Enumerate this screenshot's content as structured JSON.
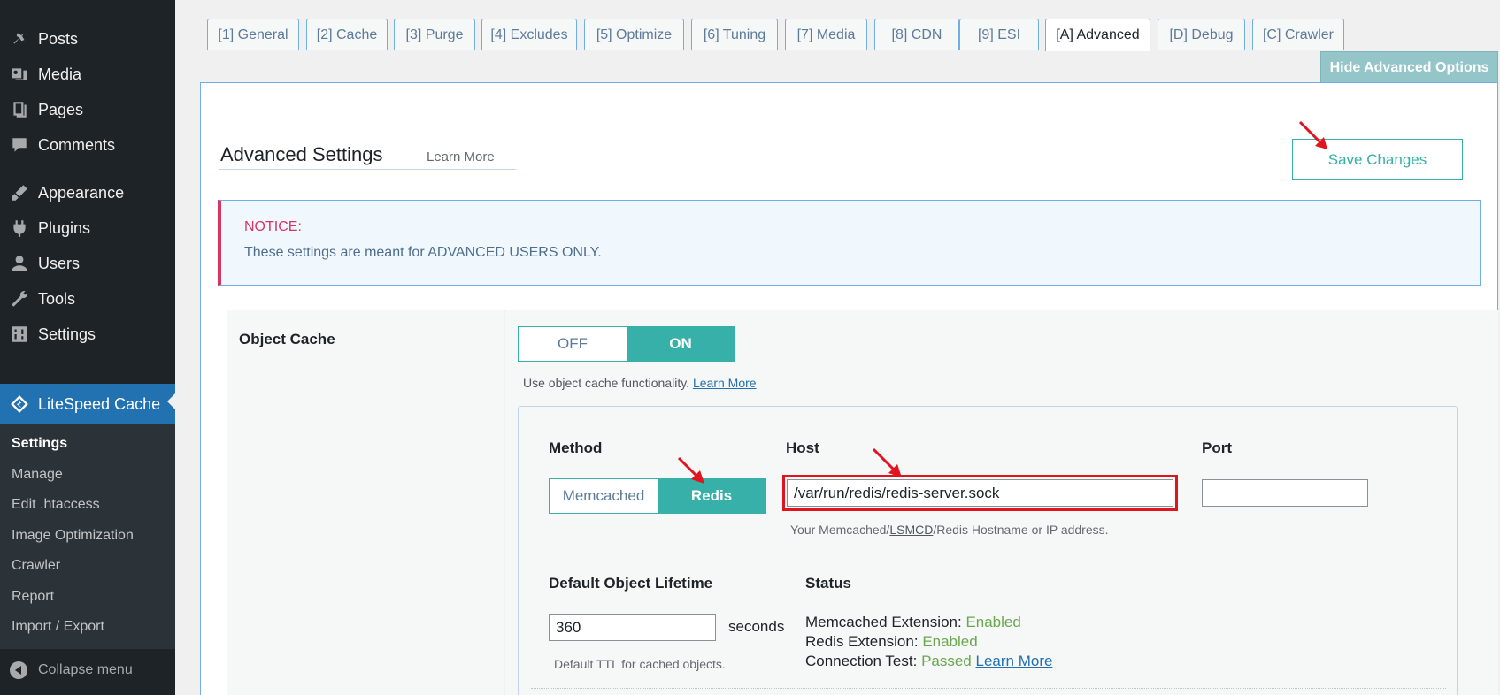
{
  "sidebar": {
    "items": [
      {
        "label": "Posts",
        "icon": "pin-icon"
      },
      {
        "label": "Media",
        "icon": "media-icon"
      },
      {
        "label": "Pages",
        "icon": "pages-icon"
      },
      {
        "label": "Comments",
        "icon": "comment-icon"
      },
      {
        "label": "Appearance",
        "icon": "brush-icon"
      },
      {
        "label": "Plugins",
        "icon": "plugin-icon"
      },
      {
        "label": "Users",
        "icon": "user-icon"
      },
      {
        "label": "Tools",
        "icon": "wrench-icon"
      },
      {
        "label": "Settings",
        "icon": "settings-icon"
      },
      {
        "label": "LiteSpeed Cache",
        "icon": "litespeed-icon"
      }
    ],
    "submenu": [
      "Settings",
      "Manage",
      "Edit .htaccess",
      "Image Optimization",
      "Crawler",
      "Report",
      "Import / Export"
    ],
    "collapse_label": "Collapse menu"
  },
  "tabs": [
    "[1] General",
    "[2] Cache",
    "[3] Purge",
    "[4] Excludes",
    "[5] Optimize",
    "[6] Tuning",
    "[7] Media",
    "[8] CDN",
    "[9] ESI",
    "[A] Advanced",
    "[D] Debug",
    "[C] Crawler"
  ],
  "hide_advanced_label": "Hide Advanced Options",
  "header": {
    "title": "Advanced Settings",
    "learn_more": "Learn More",
    "save_label": "Save Changes"
  },
  "notice": {
    "title": "NOTICE:",
    "text": "These settings are meant for ADVANCED USERS ONLY."
  },
  "object_cache": {
    "label": "Object Cache",
    "off_label": "OFF",
    "on_label": "ON",
    "description": "Use object cache functionality.",
    "learn_more": "Learn More",
    "method_label": "Method",
    "method_memcached": "Memcached",
    "method_redis": "Redis",
    "host_label": "Host",
    "host_value": "/var/run/redis/redis-server.sock",
    "host_desc_1": "Your Memcached/",
    "host_desc_link": "LSMCD",
    "host_desc_2": "/Redis Hostname or IP address.",
    "port_label": "Port",
    "port_value": "",
    "lifetime_label": "Default Object Lifetime",
    "lifetime_value": "360",
    "lifetime_unit": "seconds",
    "lifetime_desc": "Default TTL for cached objects.",
    "status_label": "Status",
    "status": {
      "memcached_label": "Memcached Extension:",
      "memcached_value": "Enabled",
      "redis_label": "Redis Extension:",
      "redis_value": "Enabled",
      "conn_label": "Connection Test:",
      "conn_value": "Passed",
      "learn_more": "Learn More"
    }
  },
  "colors": {
    "accent": "#36b0a9",
    "highlight": "#e0141e",
    "sidebar": "#1d2327",
    "active_menu": "#2271b1"
  }
}
